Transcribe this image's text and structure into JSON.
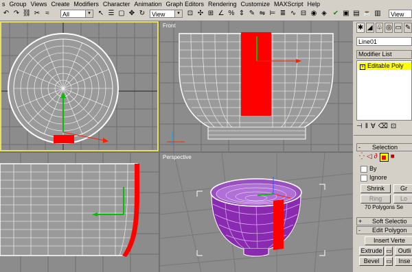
{
  "menu": [
    "s",
    "Group",
    "Views",
    "Create",
    "Modifiers",
    "Character",
    "Animation",
    "Graph Editors",
    "Rendering",
    "Customize",
    "MAXScript",
    "Help"
  ],
  "toolbar": {
    "selection_filter": "All",
    "ref_coord_left": "View",
    "ref_coord_right": "View"
  },
  "viewports": {
    "top_right_label": "Front",
    "bottom_right_label": "Perspective"
  },
  "command_panel": {
    "object_name": "Line01",
    "modifier_list_label": "Modifier List",
    "stack_item": "Editable Poly",
    "selection_rollout": "Selection",
    "by_vertex_label": "By",
    "ignore_backfacing_label": "Ignore",
    "shrink_button": "Shrink",
    "grow_button": "Gr",
    "ring_button": "Ring",
    "loop_button": "Lo",
    "selection_status": "70 Polygons Se",
    "soft_selection_rollout": "Soft Selectio",
    "edit_polygons_rollout": "Edit Polygon",
    "insert_vertex_button": "Insert Verte",
    "extrude_button": "Extrude",
    "outline_button": "Outli",
    "bevel_button": "Bevel",
    "inset_button": "Inse"
  },
  "colors": {
    "selection_red": "#ff0000",
    "active_border": "#e8e060",
    "purple_face": "#8a2ab0",
    "grid_white": "#ffffff"
  }
}
